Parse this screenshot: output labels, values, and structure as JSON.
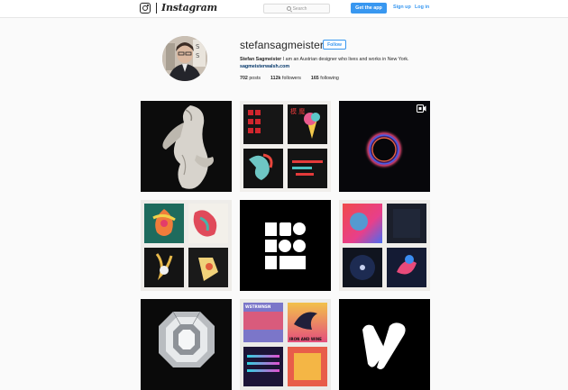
{
  "topbar": {
    "logo_icon": "instagram-camera-icon",
    "logo_text": "Instagram",
    "search_placeholder": "Search",
    "search_icon": "search-icon",
    "get_app_label": "Get the app",
    "sign_up_label": "Sign up",
    "log_in_label": "Log in",
    "accent_color": "#3897f0"
  },
  "profile": {
    "username": "stefansagmeister",
    "follow_label": "Follow",
    "full_name": "Stefan Sagmeister",
    "bio_text": "I am an Austrian designer who lives and works in New York.",
    "website": "sagmeisterwalsh.com",
    "posts_count": "702",
    "posts_label": "posts",
    "followers_count": "112k",
    "followers_label": "followers",
    "following_count": "165",
    "following_label": "following"
  },
  "grid": {
    "tiles": [
      {
        "subject": "marble-sculpture"
      },
      {
        "subject": "album-covers-red-black"
      },
      {
        "subject": "glowing-ring-video",
        "badge_icon": "video-icon"
      },
      {
        "subject": "illustrated-album-covers"
      },
      {
        "subject": "geometric-logo-black"
      },
      {
        "subject": "colorful-album-covers"
      },
      {
        "subject": "diamond"
      },
      {
        "subject": "album-covers-stack",
        "cover_text_1": "WSTRWNSN",
        "cover_text_2": "IRON AND WINE"
      },
      {
        "subject": "v-logo-black"
      }
    ]
  }
}
